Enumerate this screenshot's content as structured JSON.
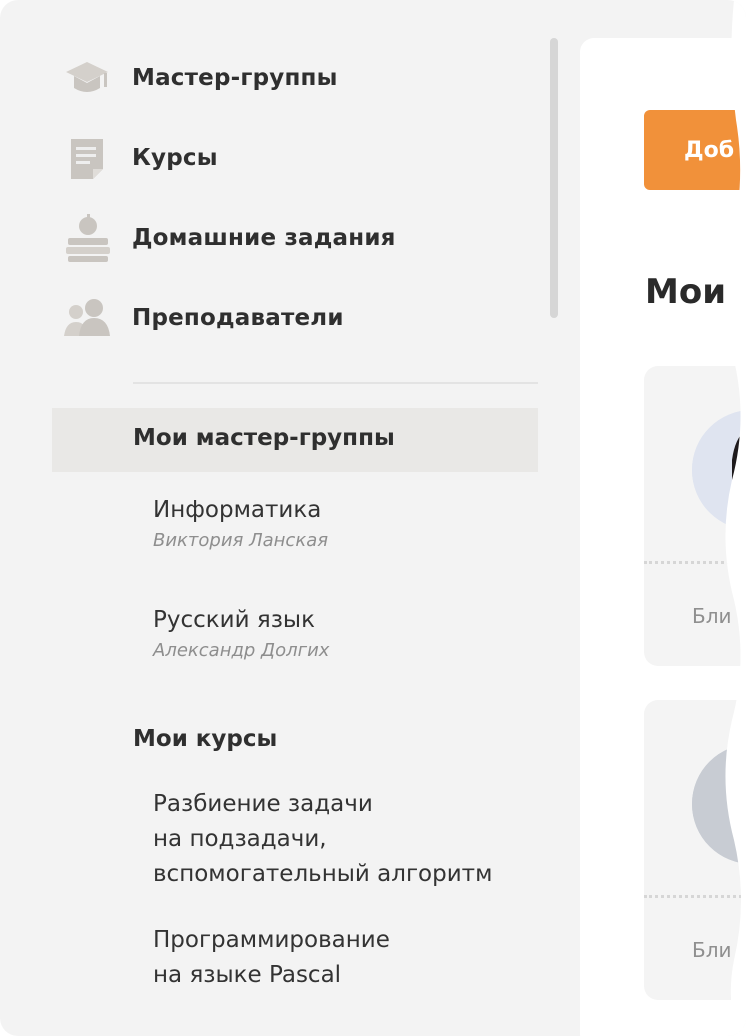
{
  "sidebar": {
    "nav": [
      {
        "label": "Мастер-группы",
        "icon": "graduation-cap-icon"
      },
      {
        "label": "Курсы",
        "icon": "document-icon"
      },
      {
        "label": "Домашние задания",
        "icon": "books-apple-icon"
      },
      {
        "label": "Преподаватели",
        "icon": "users-icon"
      }
    ],
    "groups_title": "Мои мастер-группы",
    "groups": [
      {
        "title": "Информатика",
        "author": "Виктория Ланская"
      },
      {
        "title": "Русский язык",
        "author": "Александр Долгих"
      }
    ],
    "courses_title": "Мои курсы",
    "courses": [
      {
        "lines": [
          "Разбиение задачи",
          "на подзадачи,",
          "вспомогательный алгоритм"
        ]
      },
      {
        "lines": [
          "Программирование",
          "на языке Pascal"
        ]
      }
    ]
  },
  "main": {
    "add_button_label": "Доб",
    "title": "Мои",
    "cards": [
      {
        "next_label": "Бли"
      },
      {
        "next_label": "Бли"
      }
    ]
  },
  "colors": {
    "accent": "#f1913a",
    "sidebar_bg": "#f3f3f3",
    "active_bg": "#e9e8e6",
    "icon": "#c9c5c0"
  }
}
